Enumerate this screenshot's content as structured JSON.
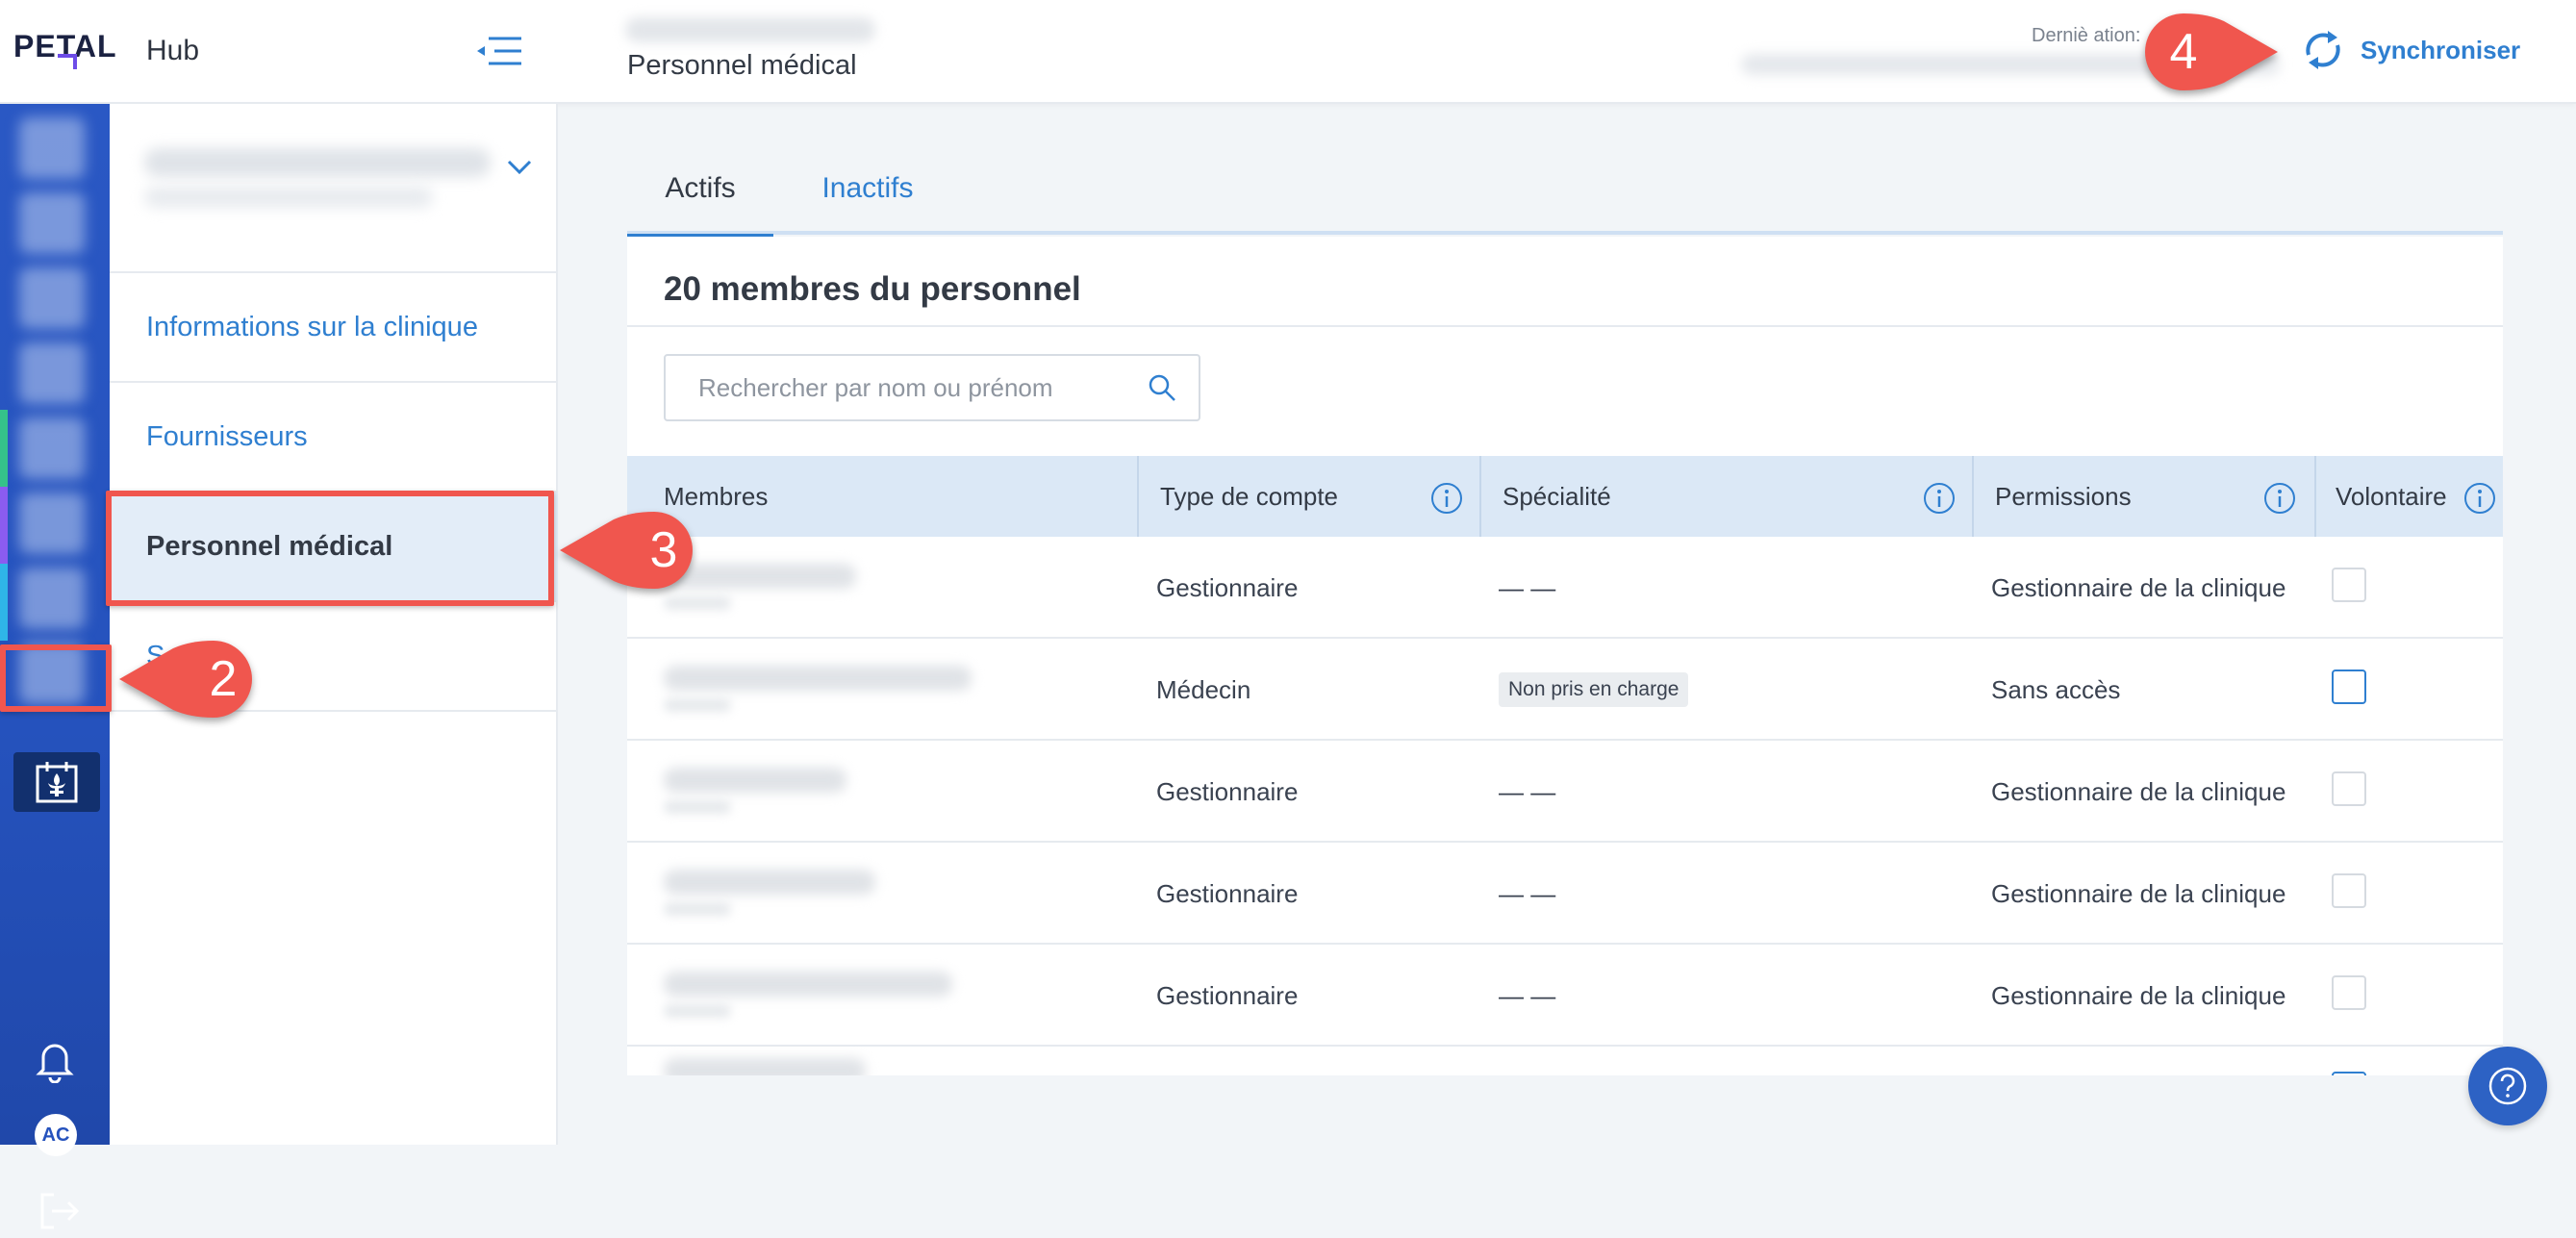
{
  "app": {
    "logo_text": "PETAL",
    "hub_title": "Hub",
    "page_title": "Personnel médical",
    "last_sync_label": "Derniè    ation:",
    "sync_label": "Synchroniser"
  },
  "sidebar": {
    "items": [
      {
        "label": "Informations sur la clinique"
      },
      {
        "label": "Fournisseurs"
      },
      {
        "label": "Personnel médical"
      },
      {
        "label": "S          c"
      }
    ],
    "avatar_initials": "AC"
  },
  "tabs": [
    {
      "label": "Actifs"
    },
    {
      "label": "Inactifs"
    }
  ],
  "staff": {
    "count_title": "20 membres du personnel",
    "search_placeholder": "Rechercher par nom ou prénom",
    "columns": [
      "Membres",
      "Type de compte",
      "Spécialité",
      "Permissions",
      "Volontaire"
    ],
    "rows": [
      {
        "type": "Gestionnaire",
        "specialty": "— —",
        "permissions": "Gestionnaire de la clinique",
        "volunteer": false
      },
      {
        "type": "Médecin",
        "specialty": "Non pris en charge",
        "permissions": "Sans accès",
        "volunteer": false
      },
      {
        "type": "Gestionnaire",
        "specialty": "— —",
        "permissions": "Gestionnaire de la clinique",
        "volunteer": false
      },
      {
        "type": "Gestionnaire",
        "specialty": "— —",
        "permissions": "Gestionnaire de la clinique",
        "volunteer": false
      },
      {
        "type": "Gestionnaire",
        "specialty": "— —",
        "permissions": "Gestionnaire de la clinique",
        "volunteer": false
      }
    ]
  },
  "callouts": {
    "step_2": "2",
    "step_3": "3",
    "step_4": "4"
  },
  "colors": {
    "accent": "#2f7fd0",
    "rail": "#2552bd",
    "callout": "#f0564e"
  }
}
